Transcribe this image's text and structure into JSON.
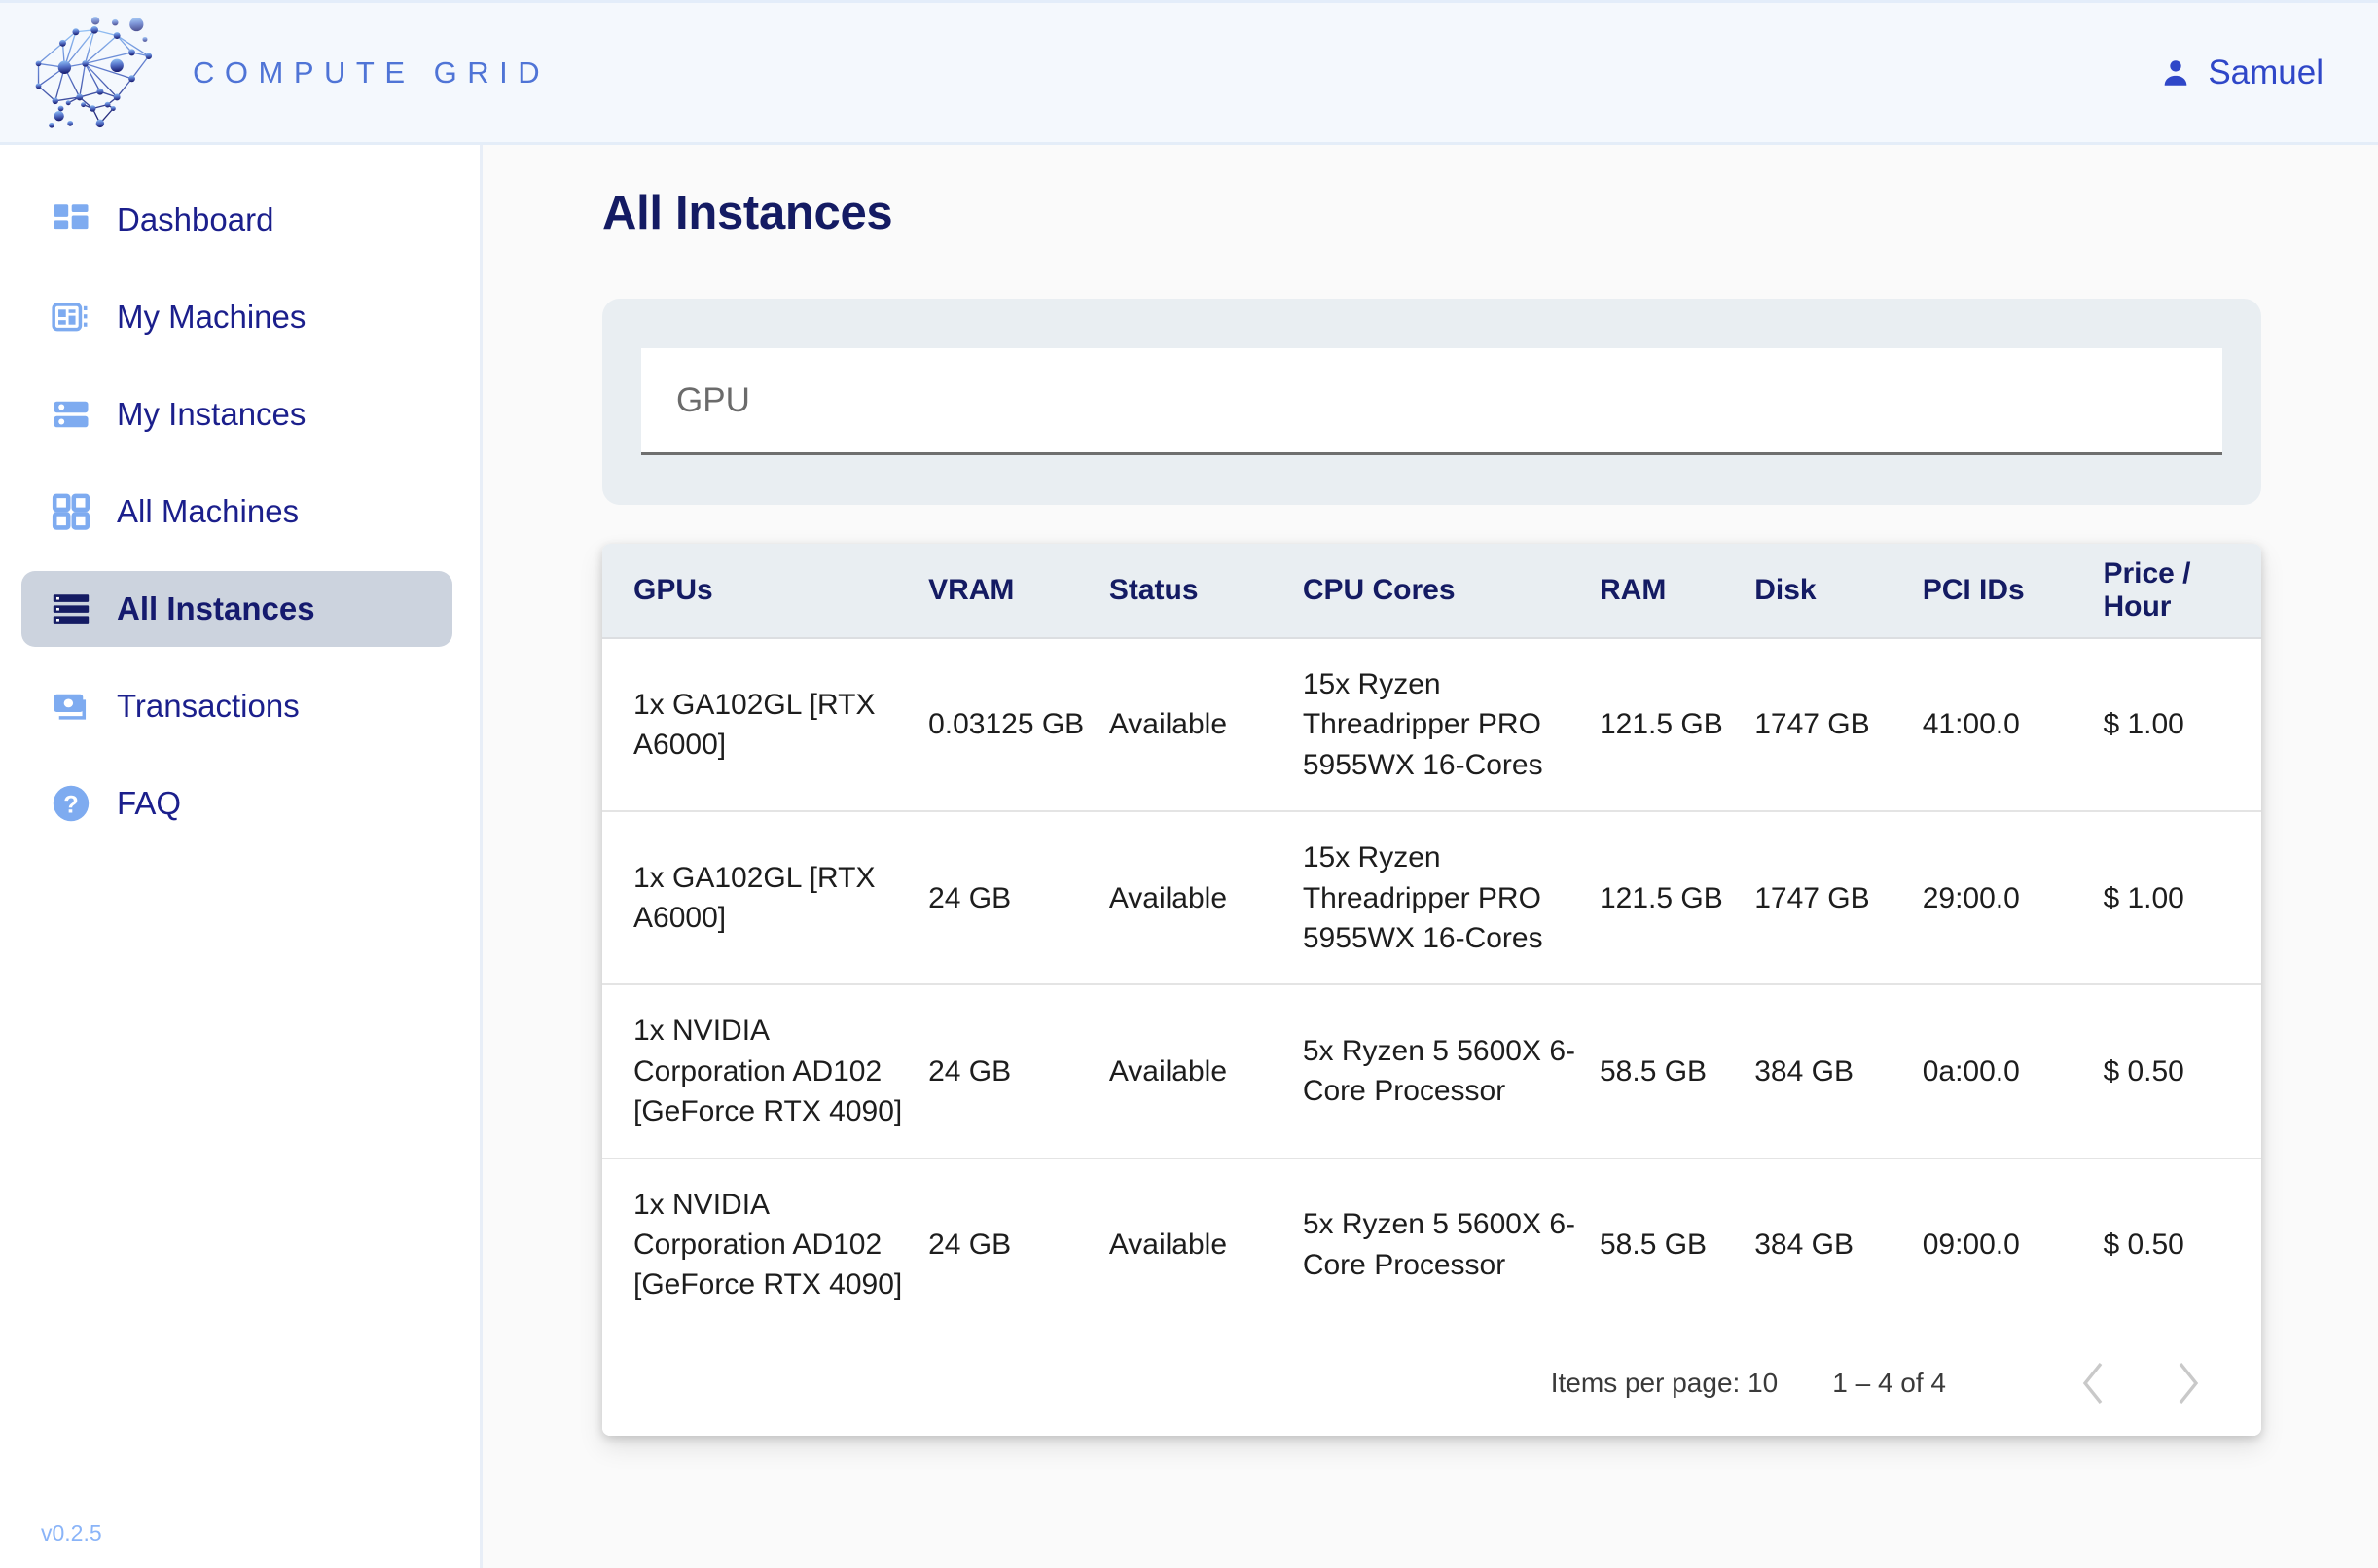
{
  "header": {
    "brand_name": "COMPUTE GRID",
    "logo_icon": "brain-network-icon",
    "user_icon": "person-icon",
    "user_name": "Samuel"
  },
  "sidebar": {
    "version": "v0.2.5",
    "items": [
      {
        "label": "Dashboard",
        "icon": "dashboard-grid-icon",
        "active": false
      },
      {
        "label": "My Machines",
        "icon": "machine-card-icon",
        "active": false
      },
      {
        "label": "My Instances",
        "icon": "server-stack-icon",
        "active": false
      },
      {
        "label": "All Machines",
        "icon": "grid-squares-icon",
        "active": false
      },
      {
        "label": "All Instances",
        "icon": "server-list-icon",
        "active": true
      },
      {
        "label": "Transactions",
        "icon": "banknote-icon",
        "active": false
      },
      {
        "label": "FAQ",
        "icon": "question-circle-icon",
        "active": false
      }
    ]
  },
  "main": {
    "title": "All Instances",
    "search": {
      "placeholder": "GPU",
      "value": ""
    },
    "table": {
      "columns": [
        "GPUs",
        "VRAM",
        "Status",
        "CPU Cores",
        "RAM",
        "Disk",
        "PCI\nIDs",
        "Price /\nHour"
      ],
      "columns_flat": [
        "GPUs",
        "VRAM",
        "Status",
        "CPU Cores",
        "RAM",
        "Disk",
        "PCI IDs",
        "Price / Hour"
      ],
      "rows": [
        {
          "gpus": "1x GA102GL [RTX A6000]",
          "vram": "0.03125 GB",
          "status": "Available",
          "cpu_cores": "15x Ryzen Threadripper PRO 5955WX 16-Cores",
          "ram": "121.5 GB",
          "disk": "1747 GB",
          "pci_ids": "41:00.0",
          "price_hour": "$ 1.00"
        },
        {
          "gpus": "1x GA102GL [RTX A6000]",
          "vram": "24 GB",
          "status": "Available",
          "cpu_cores": "15x Ryzen Threadripper PRO 5955WX 16-Cores",
          "ram": "121.5 GB",
          "disk": "1747 GB",
          "pci_ids": "29:00.0",
          "price_hour": "$ 1.00"
        },
        {
          "gpus": "1x NVIDIA Corporation AD102 [GeForce RTX 4090]",
          "vram": "24 GB",
          "status": "Available",
          "cpu_cores": "5x Ryzen 5 5600X 6-Core Processor",
          "ram": "58.5 GB",
          "disk": "384 GB",
          "pci_ids": "0a:00.0",
          "price_hour": "$ 0.50"
        },
        {
          "gpus": "1x NVIDIA Corporation AD102 [GeForce RTX 4090]",
          "vram": "24 GB",
          "status": "Available",
          "cpu_cores": "5x Ryzen 5 5600X 6-Core Processor",
          "ram": "58.5 GB",
          "disk": "384 GB",
          "pci_ids": "09:00.0",
          "price_hour": "$ 0.50"
        }
      ]
    },
    "paginator": {
      "items_per_page_label": "Items per page: 10",
      "range_label": "1 – 4 of 4",
      "prev_icon": "chevron-left-icon",
      "next_icon": "chevron-right-icon"
    }
  },
  "colors": {
    "brand_blue": "#4f74d6",
    "navy": "#141b63",
    "accent_light_blue": "#8ab4f8",
    "topbar_bg": "#f4f8fd",
    "main_bg": "#fafafa",
    "card_header_bg": "#e9eef2",
    "active_nav_bg": "#ccd3de",
    "user_blue": "#2f47c8"
  }
}
